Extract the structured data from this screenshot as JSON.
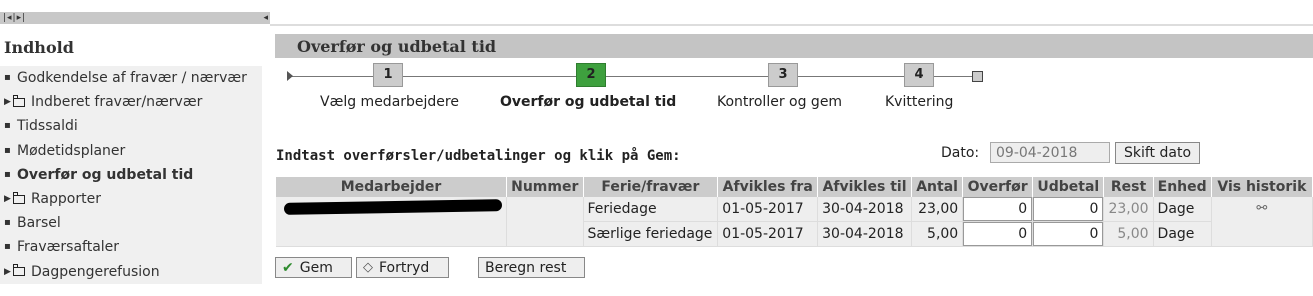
{
  "sidebar": {
    "title": "Indhold",
    "items": [
      {
        "label": "Godkendelse af fravær / nærvær",
        "type": "leaf"
      },
      {
        "label": "Indberet fravær/nærvær",
        "type": "folder"
      },
      {
        "label": "Tidssaldi",
        "type": "leaf"
      },
      {
        "label": "Mødetidsplaner",
        "type": "leaf"
      },
      {
        "label": "Overfør og udbetal tid",
        "type": "leaf",
        "active": true
      },
      {
        "label": "Rapporter",
        "type": "folder"
      },
      {
        "label": "Barsel",
        "type": "leaf"
      },
      {
        "label": "Fraværsaftaler",
        "type": "leaf"
      },
      {
        "label": "Dagpengerefusion",
        "type": "folder"
      }
    ]
  },
  "main": {
    "title": "Overfør og udbetal tid"
  },
  "wizard": {
    "steps": [
      {
        "number": "1",
        "label": "Vælg medarbejdere"
      },
      {
        "number": "2",
        "label": "Overfør og udbetal tid",
        "active": true
      },
      {
        "number": "3",
        "label": "Kontroller og gem"
      },
      {
        "number": "4",
        "label": "Kvittering"
      }
    ],
    "active_color": "#3ea03e"
  },
  "instructions": "Indtast overførsler/udbetalinger og klik på Gem:",
  "date": {
    "label": "Dato:",
    "value": "09-04-2018",
    "button": "Skift dato"
  },
  "table": {
    "columns": [
      "Medarbejder",
      "Nummer",
      "Ferie/fravær",
      "Afvikles fra",
      "Afvikles til",
      "Antal",
      "Overfør",
      "Udbetal",
      "Rest",
      "Enhed",
      "Vis historik"
    ],
    "rows": [
      {
        "type": "Feriedage",
        "from": "01-05-2017",
        "to": "30-04-2018",
        "antal": "23,00",
        "overfor": "0",
        "udbetal": "0",
        "rest": "23,00",
        "enhed": "Dage"
      },
      {
        "type": "Særlige feriedage",
        "from": "01-05-2017",
        "to": "30-04-2018",
        "antal": "5,00",
        "overfor": "0",
        "udbetal": "0",
        "rest": "5,00",
        "enhed": "Dage"
      }
    ]
  },
  "buttons": {
    "gem": "Gem",
    "fortryd": "Fortryd",
    "beregn": "Beregn rest"
  },
  "icons": {
    "history": "history-link-icon",
    "gem": "checkmark-icon",
    "fortryd": "diamond-icon"
  }
}
